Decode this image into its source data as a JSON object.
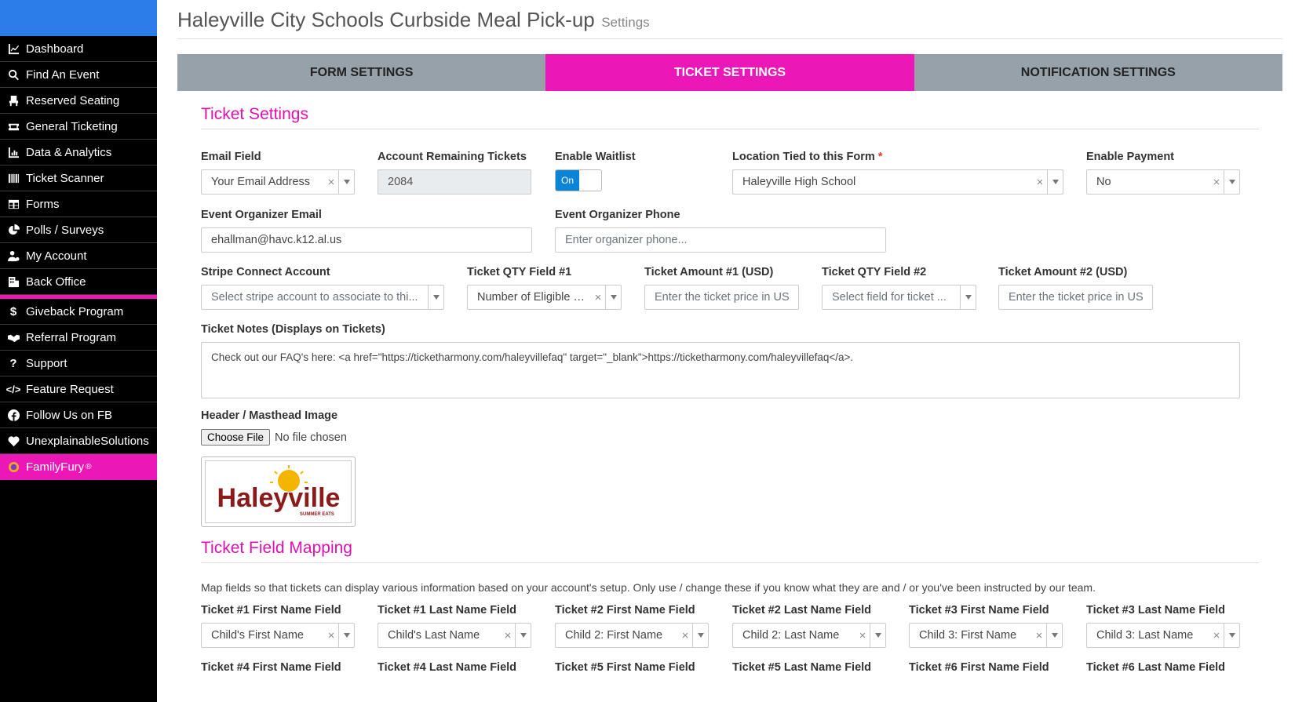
{
  "sidebar": {
    "items": [
      {
        "label": "Dashboard",
        "icon": "chart-line-icon"
      },
      {
        "label": "Find An Event",
        "icon": "search-icon"
      },
      {
        "label": "Reserved Seating",
        "icon": "seat-icon"
      },
      {
        "label": "General Ticketing",
        "icon": "ticket-icon"
      },
      {
        "label": "Data & Analytics",
        "icon": "bar-chart-icon"
      },
      {
        "label": "Ticket Scanner",
        "icon": "barcode-icon"
      },
      {
        "label": "Forms",
        "icon": "table-icon"
      },
      {
        "label": "Polls / Surveys",
        "icon": "pie-chart-icon"
      },
      {
        "label": "My Account",
        "icon": "user-gear-icon"
      },
      {
        "label": "Back Office",
        "icon": "building-icon"
      },
      {
        "label": "Giveback Program",
        "icon": "dollar-icon"
      },
      {
        "label": "Referral Program",
        "icon": "handshake-icon"
      },
      {
        "label": "Support",
        "icon": "question-icon"
      },
      {
        "label": "Feature Request",
        "icon": "code-icon"
      },
      {
        "label": "Follow Us on FB",
        "icon": "facebook-icon"
      },
      {
        "label": "UnexplainableSolutions",
        "icon": "heart-icon"
      },
      {
        "label": "FamilyFury",
        "icon": "familyfury-logo-icon",
        "sup": "®"
      }
    ],
    "brand_color": "#2b7de9",
    "accent_color": "#ec17b7"
  },
  "header": {
    "title": "Haleyville City Schools Curbside Meal Pick-up",
    "subtitle": "Settings"
  },
  "tabs": [
    {
      "label": "FORM SETTINGS",
      "active": false
    },
    {
      "label": "TICKET SETTINGS",
      "active": true
    },
    {
      "label": "NOTIFICATION SETTINGS",
      "active": false
    }
  ],
  "ticket_settings": {
    "section_title": "Ticket Settings",
    "email_field": {
      "label": "Email Field",
      "value": "Your Email Address"
    },
    "remaining_tickets": {
      "label": "Account Remaining Tickets",
      "value": "2084"
    },
    "waitlist": {
      "label": "Enable Waitlist",
      "toggle_text": "On"
    },
    "location": {
      "label": "Location Tied to this Form",
      "required_mark": "*",
      "value": "Haleyville High School"
    },
    "payment": {
      "label": "Enable Payment",
      "value": "No"
    },
    "organizer_email": {
      "label": "Event Organizer Email",
      "value": "ehallman@havc.k12.al.us"
    },
    "organizer_phone": {
      "label": "Event Organizer Phone",
      "placeholder": "Enter organizer phone..."
    },
    "stripe": {
      "label": "Stripe Connect Account",
      "placeholder": "Select stripe account to associate to thi..."
    },
    "qty1": {
      "label": "Ticket QTY Field #1",
      "value": "Number of Eligible C..."
    },
    "amount1": {
      "label": "Ticket Amount #1 (USD)",
      "placeholder": "Enter the ticket price in US"
    },
    "qty2": {
      "label": "Ticket QTY Field #2",
      "placeholder": "Select field for ticket ..."
    },
    "amount2": {
      "label": "Ticket Amount #2 (USD)",
      "placeholder": "Enter the ticket price in US"
    },
    "notes": {
      "label": "Ticket Notes (Displays on Tickets)",
      "value": "Check out our FAQ's here: <a href=\"https://ticketharmony.com/haleyvillefaq\" target=\"_blank\">https://ticketharmony.com/haleyvillefaq</a>."
    },
    "masthead": {
      "label": "Header / Masthead Image",
      "button": "Choose File",
      "status": "No file chosen",
      "logo_text": "Haleyville",
      "logo_sub": "SUMMER EATS"
    }
  },
  "mapping": {
    "section_title": "Ticket Field Mapping",
    "note": "Map fields so that tickets can display various information based on your account's setup. Only use / change these if you know what they are and / or you've been instructed by our team.",
    "row1": [
      {
        "label": "Ticket #1 First Name Field",
        "value": "Child's First Name"
      },
      {
        "label": "Ticket #1 Last Name Field",
        "value": "Child's Last Name"
      },
      {
        "label": "Ticket #2 First Name Field",
        "value": "Child 2: First Name"
      },
      {
        "label": "Ticket #2 Last Name Field",
        "value": "Child 2: Last Name"
      },
      {
        "label": "Ticket #3 First Name Field",
        "value": "Child 3: First Name"
      },
      {
        "label": "Ticket #3 Last Name Field",
        "value": "Child 3: Last Name"
      }
    ],
    "row2": [
      {
        "label": "Ticket #4 First Name Field"
      },
      {
        "label": "Ticket #4 Last Name Field"
      },
      {
        "label": "Ticket #5 First Name Field"
      },
      {
        "label": "Ticket #5 Last Name Field"
      },
      {
        "label": "Ticket #6 First Name Field"
      },
      {
        "label": "Ticket #6 Last Name Field"
      }
    ]
  }
}
